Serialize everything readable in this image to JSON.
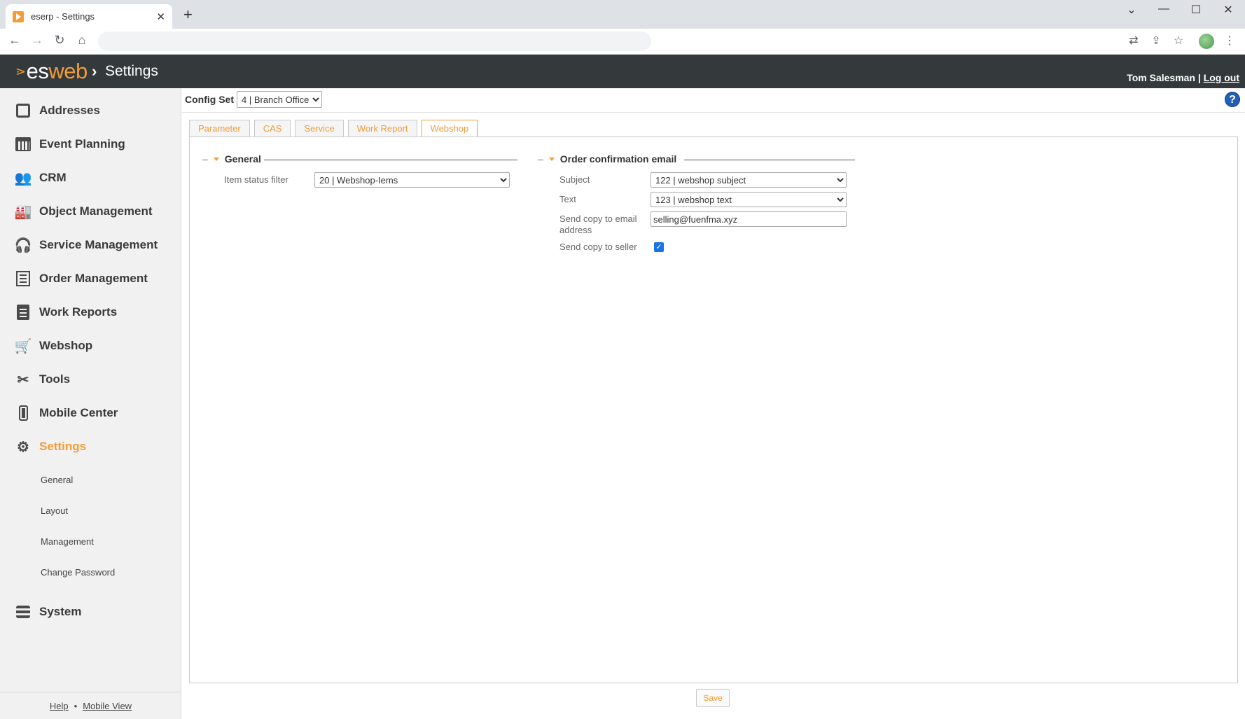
{
  "browser": {
    "tab_title": "eserp - Settings",
    "tab_close": "✕",
    "new_tab": "+",
    "min": "—",
    "max": "☐",
    "close": "✕",
    "chevron": "⌄"
  },
  "header": {
    "logo_es": "es",
    "logo_web": "web",
    "separator": "›",
    "breadcrumb": "Settings",
    "user": "Tom Salesman",
    "divider": "|",
    "logout": "Log out"
  },
  "sidebar": {
    "items": [
      {
        "label": "Addresses",
        "icon": "address-book-icon"
      },
      {
        "label": "Event Planning",
        "icon": "calendar-icon"
      },
      {
        "label": "CRM",
        "icon": "users-icon"
      },
      {
        "label": "Object Management",
        "icon": "factory-icon"
      },
      {
        "label": "Service Management",
        "icon": "headset-icon"
      },
      {
        "label": "Order Management",
        "icon": "list-icon"
      },
      {
        "label": "Work Reports",
        "icon": "clipboard-icon"
      },
      {
        "label": "Webshop",
        "icon": "cart-icon"
      },
      {
        "label": "Tools",
        "icon": "tools-icon"
      },
      {
        "label": "Mobile Center",
        "icon": "mobile-icon"
      },
      {
        "label": "Settings",
        "icon": "gear-icon",
        "active": true
      },
      {
        "label": "System",
        "icon": "server-icon"
      }
    ],
    "subitems": [
      "General",
      "Layout",
      "Management",
      "Change Password"
    ],
    "footer": {
      "help": "Help",
      "dot": "•",
      "mobile": "Mobile View"
    }
  },
  "config": {
    "label": "Config Set",
    "value": "4 | Branch Office",
    "help": "?"
  },
  "tabs": [
    "Parameter",
    "CAS",
    "Service",
    "Work Report",
    "Webshop"
  ],
  "active_tab": "Webshop",
  "general": {
    "dash": "–",
    "title": "General",
    "item_status_label": "Item status filter",
    "item_status_value": "20 | Webshop-Iems"
  },
  "order_email": {
    "dash": "–",
    "title": "Order confirmation email",
    "subject_label": "Subject",
    "subject_value": "122 | webshop subject",
    "text_label": "Text",
    "text_value": "123 | webshop text",
    "copy_email_label": "Send copy to email address",
    "copy_email_value": "selling@fuenfma.xyz",
    "copy_seller_label": "Send copy to seller",
    "copy_seller_checked": true
  },
  "save_label": "Save",
  "colors": {
    "accent": "#f29c38",
    "header_bg": "#343a3b",
    "help_blue": "#1f5fb5"
  }
}
